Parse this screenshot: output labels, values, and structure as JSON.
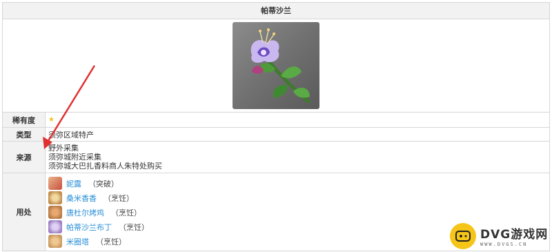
{
  "title": "帕蒂沙兰",
  "rows": {
    "rarity": {
      "label": "稀有度",
      "star": "★"
    },
    "type": {
      "label": "类型",
      "value": "须弥区域特产"
    },
    "source": {
      "label": "来源",
      "lines": [
        "野外采集",
        "须弥城附近采集",
        "须弥城大巴扎香料商人朱特处购买"
      ]
    },
    "usage": {
      "label": "用处",
      "items": [
        {
          "name": "妮露",
          "tag": "（突破）",
          "thumb_color": "#c9503f"
        },
        {
          "name": "桑米香香",
          "tag": "（烹饪）",
          "thumb_color": "#c08a4a"
        },
        {
          "name": "唐杜尔烤鸡",
          "tag": "（烹饪）",
          "thumb_color": "#b57a45"
        },
        {
          "name": "帕蒂沙兰布丁",
          "tag": "（烹饪）",
          "thumb_color": "#9a7fc0"
        },
        {
          "name": "米圈塔",
          "tag": "（烹饪）",
          "thumb_color": "#c89a60"
        }
      ]
    }
  },
  "logo": {
    "main": "DVG游戏网",
    "sub": "WWW.DVGS.CN"
  },
  "colors": {
    "link": "#2a8fd8",
    "arrow": "#e03030",
    "header_bg": "#f2f2f2",
    "logo_yellow": "#f5c518"
  }
}
